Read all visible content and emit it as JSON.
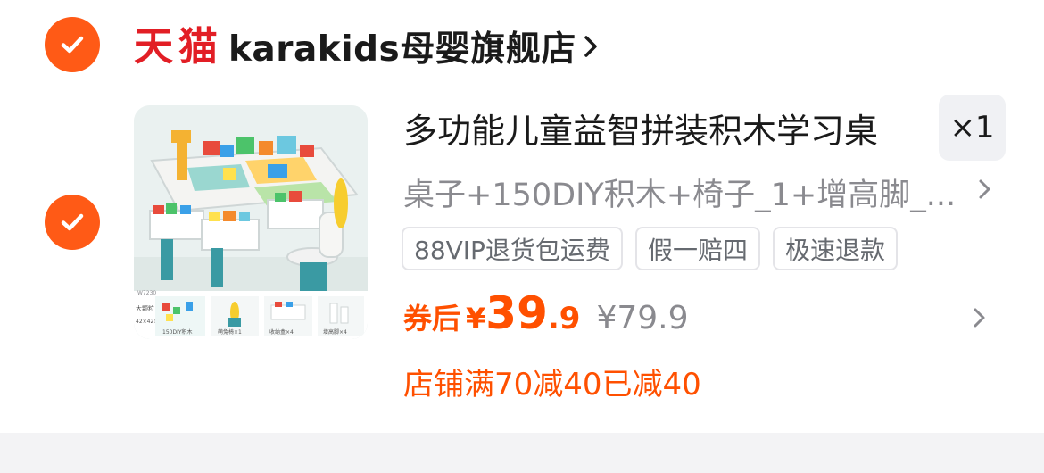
{
  "shop": {
    "platform_logo_text": "天猫",
    "name": "karakids母婴旗舰店"
  },
  "product": {
    "title": "多功能儿童益智拼装积木学习桌",
    "quantity": "×1",
    "sku": "桌子+150DIY积木+椅子_1+增高脚_...",
    "tags": [
      "88VIP退货包运费",
      "假一赔四",
      "极速退款"
    ],
    "price": {
      "label": "券后",
      "currency": "¥",
      "integer": "39",
      "decimal": ".9",
      "original": "¥79.9"
    },
    "promo": "店铺满70减40已减40",
    "thumbnail": {
      "size_text": "42×42×39 cm",
      "side_text": "大颗粒",
      "code": "W7230",
      "labels": [
        "150DIY积木",
        "萌兔椅×1",
        "收纳盒×4",
        "增高脚×4"
      ]
    }
  },
  "colors": {
    "accent": "#ff5a16",
    "price": "#ff5000",
    "tmall_red": "#e21e25",
    "muted_text": "#8a8a8f"
  }
}
